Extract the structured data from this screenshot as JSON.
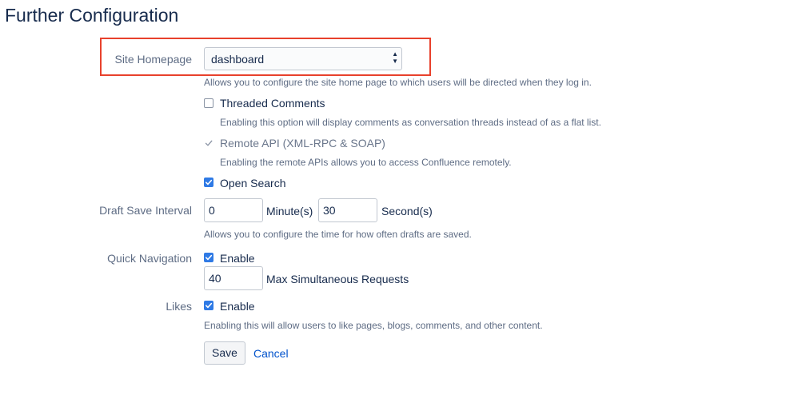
{
  "page": {
    "title": "Further Configuration"
  },
  "site_homepage": {
    "label": "Site Homepage",
    "value": "dashboard",
    "description": "Allows you to configure the site home page to which users will be directed when they log in."
  },
  "threaded_comments": {
    "label": "Threaded Comments",
    "checked": false,
    "description": "Enabling this option will display comments as conversation threads instead of as a flat list."
  },
  "remote_api": {
    "label": "Remote API (XML-RPC & SOAP)",
    "checked": true,
    "disabled": true,
    "description": "Enabling the remote APIs allows you to access Confluence remotely."
  },
  "open_search": {
    "label": "Open Search",
    "checked": true
  },
  "draft_save_interval": {
    "label": "Draft Save Interval",
    "minutes_value": "0",
    "minutes_unit": "Minute(s)",
    "seconds_value": "30",
    "seconds_unit": "Second(s)",
    "description": "Allows you to configure the time for how often drafts are saved."
  },
  "quick_navigation": {
    "label": "Quick Navigation",
    "enable_label": "Enable",
    "checked": true,
    "max_requests_value": "40",
    "max_requests_label": "Max Simultaneous Requests"
  },
  "likes": {
    "label": "Likes",
    "enable_label": "Enable",
    "checked": true,
    "description": "Enabling this will allow users to like pages, blogs, comments, and other content."
  },
  "actions": {
    "save_label": "Save",
    "cancel_label": "Cancel"
  },
  "colors": {
    "accent": "#2f7ae5",
    "link": "#0052cc",
    "highlight": "#e8412c"
  }
}
